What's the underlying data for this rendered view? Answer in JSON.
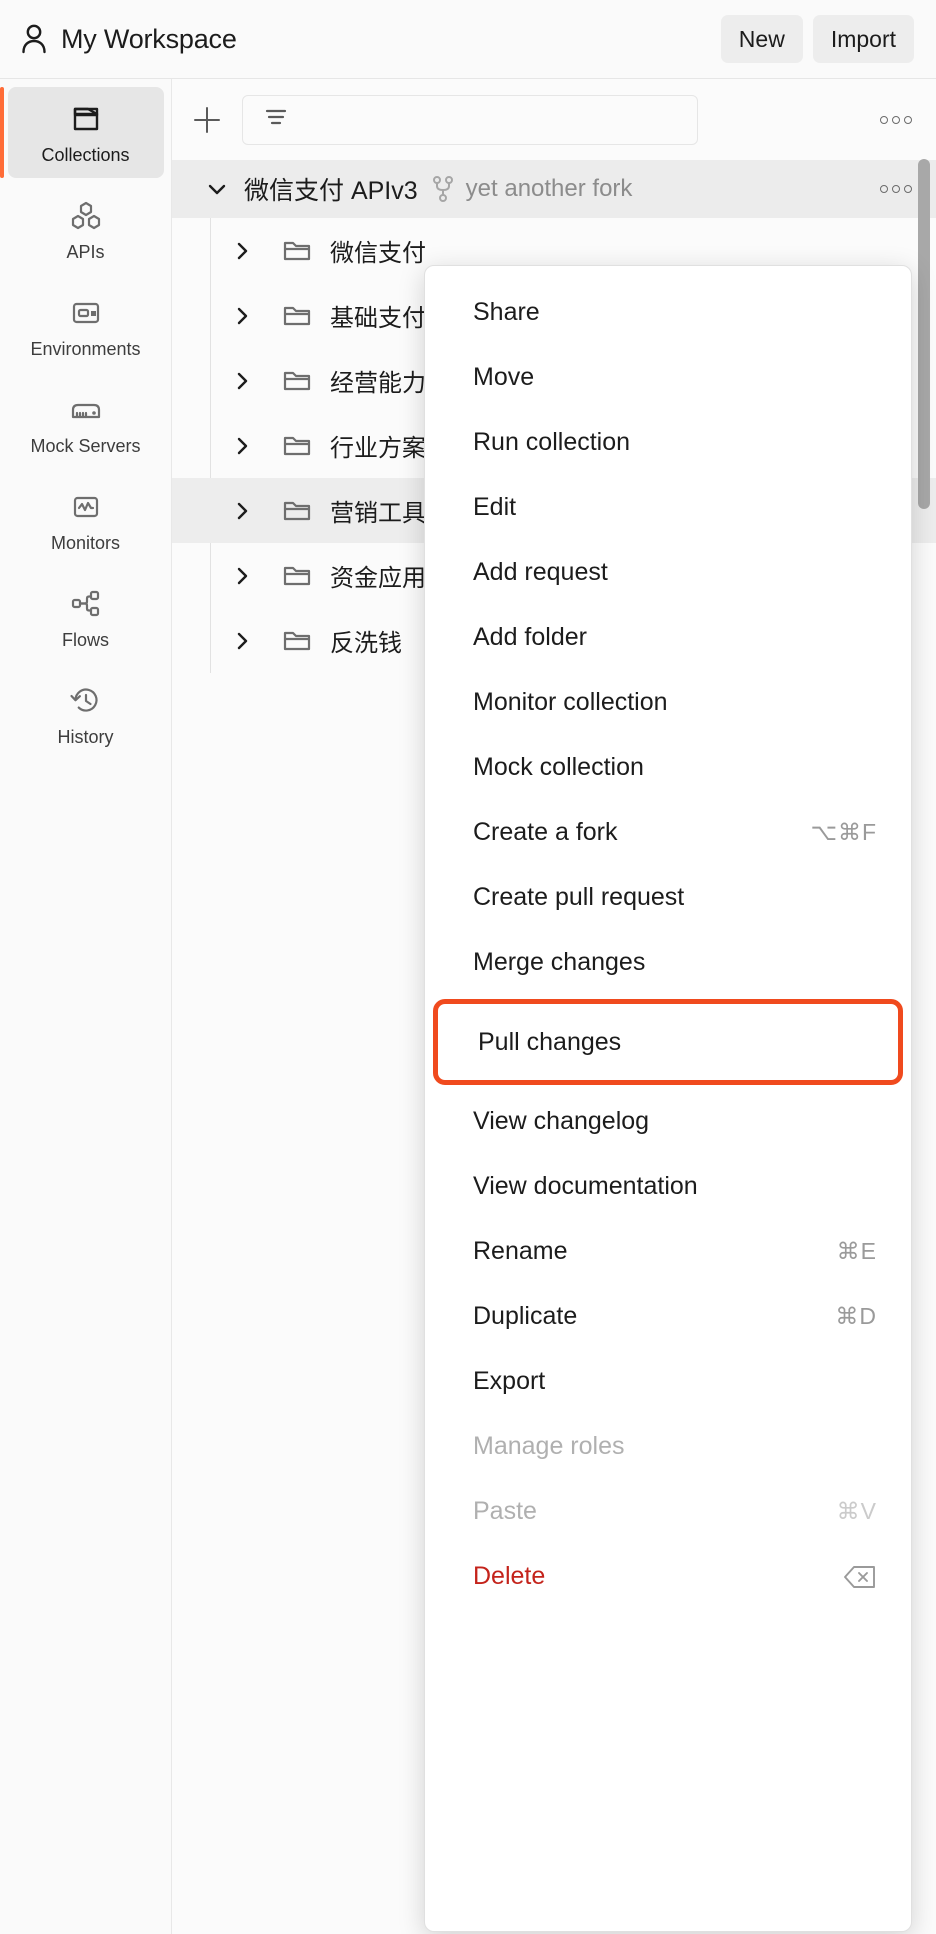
{
  "topbar": {
    "workspace_title": "My Workspace",
    "user_icon": "person-icon",
    "new_label": "New",
    "import_label": "Import"
  },
  "sidebar": {
    "items": [
      {
        "label": "Collections",
        "icon": "collections-icon",
        "active": true
      },
      {
        "label": "APIs",
        "icon": "apis-icon",
        "active": false
      },
      {
        "label": "Environments",
        "icon": "environments-icon",
        "active": false
      },
      {
        "label": "Mock Servers",
        "icon": "mock-servers-icon",
        "active": false
      },
      {
        "label": "Monitors",
        "icon": "monitors-icon",
        "active": false
      },
      {
        "label": "Flows",
        "icon": "flows-icon",
        "active": false
      },
      {
        "label": "History",
        "icon": "history-icon",
        "active": false
      }
    ],
    "active_accent": "#ff6c37"
  },
  "panel": {
    "add_icon": "plus-icon",
    "filter_icon": "filter-icon",
    "filter_placeholder": "",
    "more_icon": "ellipsis-icon"
  },
  "collection": {
    "expand_icon": "chevron-down-icon",
    "name": "微信支付 APIv3",
    "fork_icon": "fork-icon",
    "fork_label": "yet another fork",
    "more_icon": "ellipsis-icon",
    "folders": [
      {
        "name": "微信支付",
        "hover": false
      },
      {
        "name": "基础支付",
        "hover": false
      },
      {
        "name": "经营能力",
        "hover": false
      },
      {
        "name": "行业方案",
        "hover": false
      },
      {
        "name": "营销工具",
        "hover": true
      },
      {
        "name": "资金应用",
        "hover": false
      },
      {
        "name": "反洗钱",
        "hover": false
      }
    ]
  },
  "context_menu": {
    "highlight_color": "#f04a1e",
    "items": [
      {
        "label": "Share",
        "shortcut": "",
        "state": "normal"
      },
      {
        "label": "Move",
        "shortcut": "",
        "state": "normal"
      },
      {
        "label": "Run collection",
        "shortcut": "",
        "state": "normal"
      },
      {
        "label": "Edit",
        "shortcut": "",
        "state": "normal"
      },
      {
        "label": "Add request",
        "shortcut": "",
        "state": "normal"
      },
      {
        "label": "Add folder",
        "shortcut": "",
        "state": "normal"
      },
      {
        "label": "Monitor collection",
        "shortcut": "",
        "state": "normal"
      },
      {
        "label": "Mock collection",
        "shortcut": "",
        "state": "normal"
      },
      {
        "label": "Create a fork",
        "shortcut": "⌥⌘F",
        "state": "normal"
      },
      {
        "label": "Create pull request",
        "shortcut": "",
        "state": "normal"
      },
      {
        "label": "Merge changes",
        "shortcut": "",
        "state": "normal"
      },
      {
        "label": "Pull changes",
        "shortcut": "",
        "state": "highlight"
      },
      {
        "label": "View changelog",
        "shortcut": "",
        "state": "normal"
      },
      {
        "label": "View documentation",
        "shortcut": "",
        "state": "normal"
      },
      {
        "label": "Rename",
        "shortcut": "⌘E",
        "state": "normal"
      },
      {
        "label": "Duplicate",
        "shortcut": "⌘D",
        "state": "normal"
      },
      {
        "label": "Export",
        "shortcut": "",
        "state": "normal"
      },
      {
        "label": "Manage roles",
        "shortcut": "",
        "state": "disabled"
      },
      {
        "label": "Paste",
        "shortcut": "⌘V",
        "state": "disabled"
      },
      {
        "label": "Delete",
        "shortcut": "backspace-icon",
        "state": "danger"
      }
    ]
  }
}
